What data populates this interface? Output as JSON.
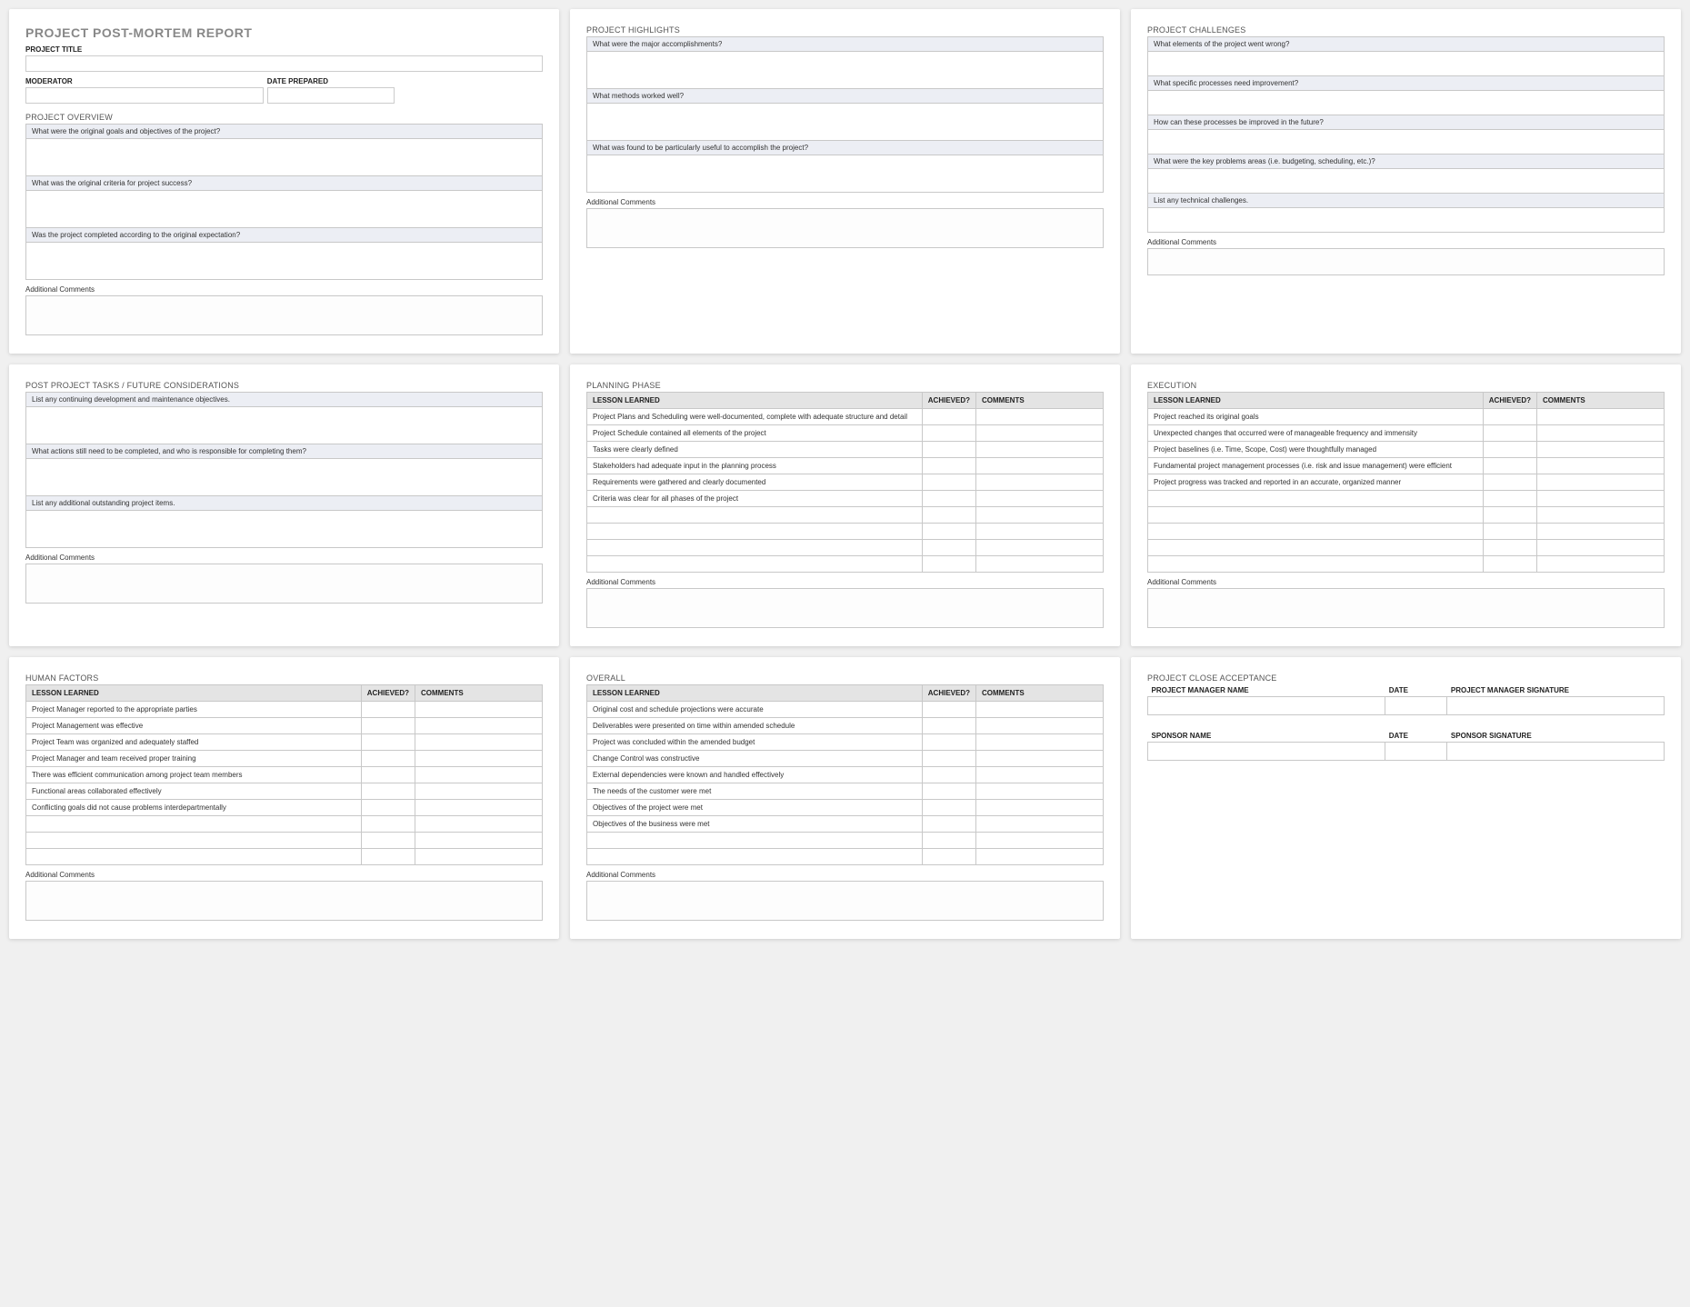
{
  "card1": {
    "main_title": "PROJECT POST-MORTEM REPORT",
    "project_title_label": "PROJECT TITLE",
    "moderator_label": "MODERATOR",
    "date_prepared_label": "DATE PREPARED",
    "overview_heading": "PROJECT OVERVIEW",
    "q1": "What were the original goals and objectives of the project?",
    "q2": "What was the original criteria for project success?",
    "q3": "Was the project completed according to the original expectation?",
    "comments_label": "Additional Comments"
  },
  "card2": {
    "heading": "PROJECT HIGHLIGHTS",
    "q1": "What were the major accomplishments?",
    "q2": "What methods worked well?",
    "q3": "What was found to be particularly useful to accomplish the project?",
    "comments_label": "Additional Comments"
  },
  "card3": {
    "heading": "PROJECT CHALLENGES",
    "q1": "What elements of the project went wrong?",
    "q2": "What specific processes need improvement?",
    "q3": "How can these processes be improved in the future?",
    "q4": "What were the key problems areas (i.e. budgeting, scheduling, etc.)?",
    "q5": "List any technical challenges.",
    "comments_label": "Additional Comments"
  },
  "card4": {
    "heading": "POST PROJECT TASKS / FUTURE CONSIDERATIONS",
    "q1": "List any continuing development and maintenance objectives.",
    "q2": "What actions still need to be completed, and who is responsible for completing them?",
    "q3": "List any additional outstanding project items.",
    "comments_label": "Additional Comments"
  },
  "card5": {
    "heading": "PLANNING PHASE",
    "th_lesson": "LESSON LEARNED",
    "th_achieved": "ACHIEVED?",
    "th_comments": "COMMENTS",
    "rows": [
      "Project Plans and Scheduling were well-documented, complete with adequate structure and detail",
      "Project Schedule contained all elements of the project",
      "Tasks were clearly defined",
      "Stakeholders had adequate input in the planning process",
      "Requirements were gathered and clearly documented",
      "Criteria was clear for all phases of the project",
      "",
      "",
      "",
      ""
    ],
    "comments_label": "Additional Comments"
  },
  "card6": {
    "heading": "EXECUTION",
    "th_lesson": "LESSON LEARNED",
    "th_achieved": "ACHIEVED?",
    "th_comments": "COMMENTS",
    "rows": [
      "Project reached its original goals",
      "Unexpected changes that occurred were of manageable frequency and immensity",
      "Project baselines (i.e. Time, Scope, Cost) were thoughtfully managed",
      "Fundamental project management processes (i.e. risk and issue management) were efficient",
      "Project progress was tracked and reported in an accurate, organized manner",
      "",
      "",
      "",
      "",
      ""
    ],
    "comments_label": "Additional Comments"
  },
  "card7": {
    "heading": "HUMAN FACTORS",
    "th_lesson": "LESSON LEARNED",
    "th_achieved": "ACHIEVED?",
    "th_comments": "COMMENTS",
    "rows": [
      "Project Manager reported to the appropriate parties",
      "Project Management was effective",
      "Project Team was organized and adequately staffed",
      "Project Manager and team received proper training",
      "There was efficient communication among project team members",
      "Functional areas collaborated effectively",
      "Conflicting goals did not cause problems interdepartmentally",
      "",
      "",
      ""
    ],
    "comments_label": "Additional Comments"
  },
  "card8": {
    "heading": "OVERALL",
    "th_lesson": "LESSON LEARNED",
    "th_achieved": "ACHIEVED?",
    "th_comments": "COMMENTS",
    "rows": [
      "Original cost and schedule projections were accurate",
      "Deliverables were presented on time within amended schedule",
      "Project was concluded within the amended budget",
      "Change Control was constructive",
      "External dependencies were known and handled effectively",
      "The needs of the customer were met",
      "Objectives of the project were met",
      "Objectives of the business were met",
      "",
      ""
    ],
    "comments_label": "Additional Comments"
  },
  "card9": {
    "heading": "PROJECT CLOSE ACCEPTANCE",
    "pm_name": "PROJECT MANAGER NAME",
    "date": "DATE",
    "pm_sig": "PROJECT MANAGER SIGNATURE",
    "sponsor_name": "SPONSOR NAME",
    "sponsor_sig": "SPONSOR SIGNATURE"
  }
}
